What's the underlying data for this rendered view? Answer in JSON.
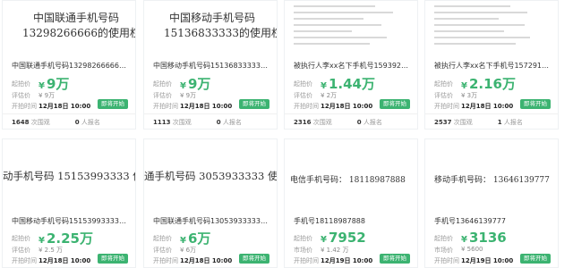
{
  "ui": {
    "label_start_price": "起拍价",
    "label_eval_price": "评估价",
    "label_market_price": "市场价",
    "label_start_time": "开拍时间",
    "label_views": "次围观",
    "label_signup": "人报名",
    "btn_label": "即将开始"
  },
  "cards": [
    {
      "thumb_line1": "中国联通手机号码",
      "thumb_line2": "13298266666的使用权",
      "title": "中国联通手机号码13298266666的使用...",
      "start_price_prefix": "¥",
      "start_price": "9万",
      "eval_price": "¥ 9万",
      "start_time": "12月18日 10:00",
      "views": "1648",
      "signups": "0"
    },
    {
      "thumb_line1": "中国移动手机号码",
      "thumb_line2": "15136833333的使用权",
      "title": "中国移动手机号码15136833333的使用...",
      "start_price_prefix": "¥",
      "start_price": "9万",
      "eval_price": "¥ 9万",
      "start_time": "12月18日 10:00",
      "views": "1113",
      "signups": "0"
    },
    {
      "title": "被执行人李xx名下手机号15939270000",
      "start_price_prefix": "¥",
      "start_price": "1.44万",
      "eval_price": "¥ 2万",
      "start_time": "12月18日 10:00",
      "views": "2316",
      "signups": "0"
    },
    {
      "title": "被执行人李xx名下手机号15729128888",
      "start_price_prefix": "¥",
      "start_price": "2.16万",
      "eval_price": "¥ 3万",
      "start_time": "12月18日 10:00",
      "views": "2537",
      "signups": "1"
    },
    {
      "thumb_line1": "动手机号码 15153993333 使用权",
      "title": "中国移动手机号码15153993333使用权...",
      "start_price_prefix": "¥",
      "start_price": "2.25万",
      "eval_price": "¥ 2.5 万",
      "start_time": "12月18日 10:00"
    },
    {
      "thumb_line1": "通手机号码 3053933333 使用",
      "title": "中国联通手机号码13053933333使用权...",
      "start_price_prefix": "¥",
      "start_price": "6万",
      "eval_price": "¥ 6万",
      "start_time": "12月18日 10:00"
    },
    {
      "thumb_line1": "电信手机号码：",
      "thumb_line2": "18118987888",
      "title": "手机号18118987888",
      "start_price_prefix": "¥",
      "start_price": "7952",
      "market_price": "¥ 1.42 万",
      "start_time": "12月19日 10:00"
    },
    {
      "thumb_line1": "移动手机号码：",
      "thumb_line2": "13646139777",
      "title": "手机号13646139777",
      "start_price_prefix": "¥",
      "start_price": "3136",
      "market_price": "¥ 5600",
      "start_time": "12月19日 10:00"
    }
  ]
}
